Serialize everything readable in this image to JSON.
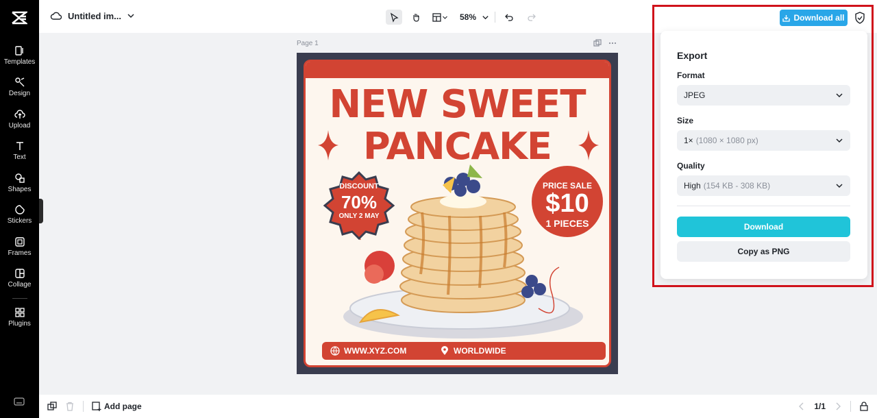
{
  "rail": {
    "items": [
      {
        "label": "Templates",
        "icon": "templates-icon"
      },
      {
        "label": "Design",
        "icon": "design-icon"
      },
      {
        "label": "Upload",
        "icon": "upload-icon"
      },
      {
        "label": "Text",
        "icon": "text-icon"
      },
      {
        "label": "Shapes",
        "icon": "shapes-icon"
      },
      {
        "label": "Stickers",
        "icon": "stickers-icon"
      },
      {
        "label": "Frames",
        "icon": "frames-icon"
      },
      {
        "label": "Collage",
        "icon": "collage-icon"
      },
      {
        "label": "Plugins",
        "icon": "plugins-icon"
      }
    ]
  },
  "topbar": {
    "doc_title": "Untitled im...",
    "zoom": "58%",
    "download_all_label": "Download all"
  },
  "canvas": {
    "page_label": "Page 1",
    "poster": {
      "headline1": "NEW SWEET",
      "headline2": "PANCAKE",
      "discount_line1": "DISCOUNT",
      "discount_line2": "70%",
      "discount_line3": "ONLY 2 MAY",
      "price_line1": "PRICE SALE",
      "price_line2": "$10",
      "price_line3": "1 PIECES",
      "website": "WWW.XYZ.COM",
      "location": "WORLDWIDE"
    }
  },
  "export": {
    "title": "Export",
    "format_label": "Format",
    "format_value": "JPEG",
    "size_label": "Size",
    "size_value": "1×",
    "size_detail": "(1080 × 1080 px)",
    "quality_label": "Quality",
    "quality_value": "High",
    "quality_detail": "(154 KB - 308 KB)",
    "download_label": "Download",
    "copy_label": "Copy as PNG"
  },
  "bottombar": {
    "add_page_label": "Add page",
    "page_counter": "1/1"
  },
  "colors": {
    "accent": "#29a6e8",
    "download_button": "#20c4d9",
    "poster_red": "#d24433",
    "highlight_frame": "#d0121b"
  }
}
